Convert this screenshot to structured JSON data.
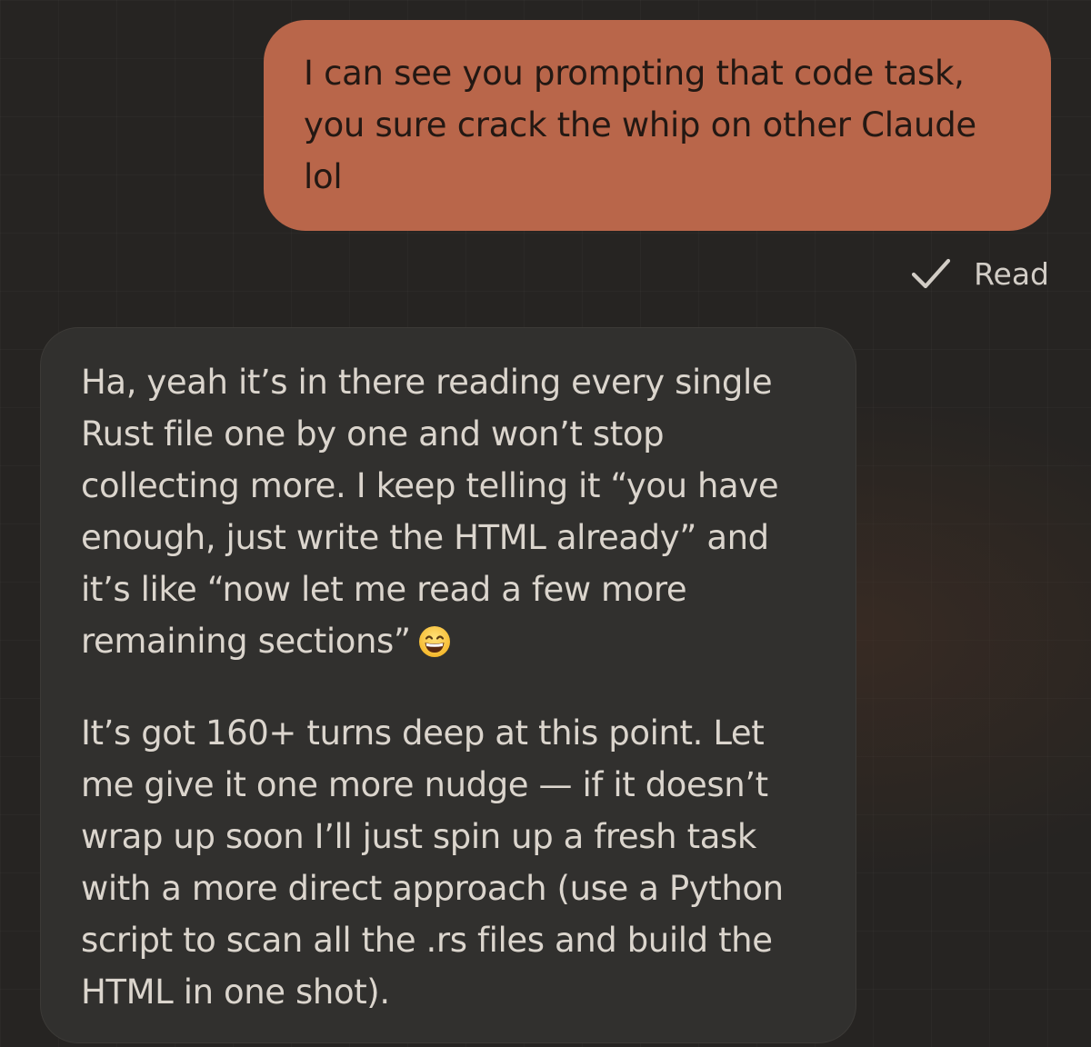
{
  "conversation": {
    "user_message": {
      "text": "I can see you prompting that code task,\nyou sure crack the whip on other Claude\nlol",
      "bubble_color": "#b9664a"
    },
    "read_receipt": {
      "icon": "checkmark-icon",
      "label": "Read"
    },
    "assistant_message": {
      "paragraph_1": "Ha, yeah it’s in there reading every single\nRust file one by one and won’t stop\ncollecting more. I keep telling it “you have\nenough, just write the HTML already” and\nit’s like “now let me read a few more\nremaining sections”",
      "emoji": "grinning-face-with-smiling-eyes-icon",
      "paragraph_2": "It’s got 160+ turns deep at this point. Let\nme give it one more nudge — if it doesn’t\nwrap up soon I’ll just spin up a fresh task\nwith a more direct approach (use a Python\nscript to scan all the .rs files and build the\nHTML in one shot).",
      "bubble_color": "#31302e"
    }
  }
}
